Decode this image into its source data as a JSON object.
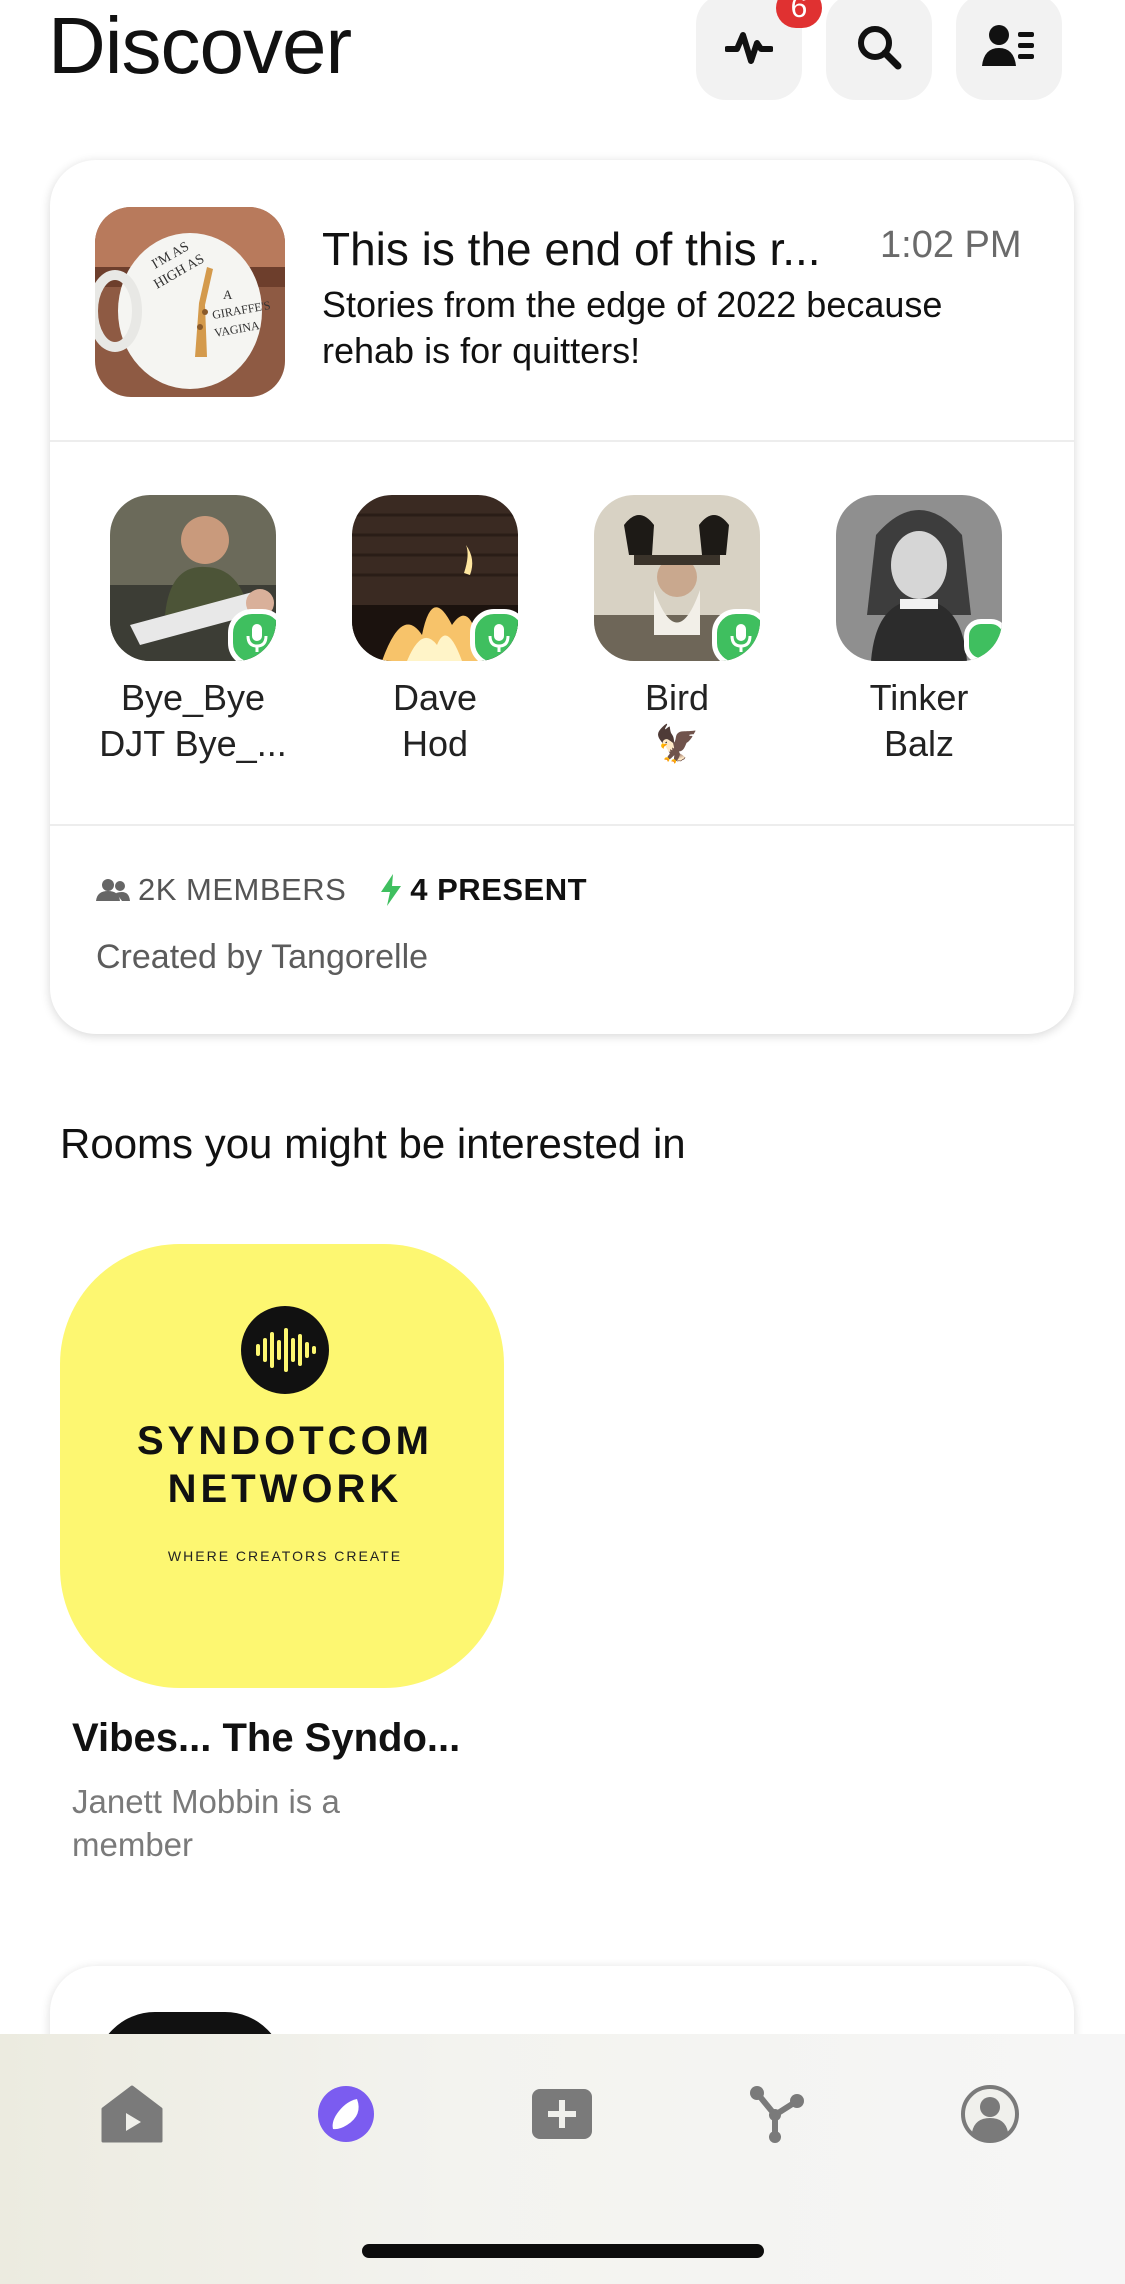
{
  "header": {
    "title": "Discover",
    "activity_badge": "6"
  },
  "featured_room": {
    "cover_text": [
      "I'M AS",
      "HIGH AS",
      "A",
      "GIRAFFE'S",
      "VAGINA"
    ],
    "title": "This is the end of this r...",
    "time": "1:02 PM",
    "description": "Stories from the edge of 2022 because rehab is for quitters!",
    "members": [
      {
        "name_line1": "Bye_Bye",
        "name_line2": "DJT Bye_...",
        "status": "speaking"
      },
      {
        "name_line1": "Dave",
        "name_line2": "Hod",
        "status": "speaking"
      },
      {
        "name_line1": "Bird",
        "name_line2": "🦅",
        "status": "speaking"
      },
      {
        "name_line1": "Tinker",
        "name_line2": "Balz",
        "status": "online"
      }
    ],
    "member_count": "2K MEMBERS",
    "present_count": "4 PRESENT",
    "created_by": "Created by Tangorelle"
  },
  "suggestions": {
    "section_title": "Rooms you might be interested in",
    "rooms": [
      {
        "logo_line1": "SYNDOTCOM",
        "logo_line2": "NETWORK",
        "logo_tagline": "WHERE CREATORS CREATE",
        "name": "Vibes... The Syndo...",
        "subtitle": "Janett Mobbin is a member"
      }
    ]
  },
  "tabbar": {
    "tabs": [
      {
        "icon": "home-icon",
        "active": false
      },
      {
        "icon": "compass-icon",
        "active": true
      },
      {
        "icon": "add-icon",
        "active": false
      },
      {
        "icon": "network-icon",
        "active": false
      },
      {
        "icon": "profile-icon",
        "active": false
      }
    ],
    "active_color": "#7b5cf0",
    "inactive_color": "#8a8a8a"
  },
  "colors": {
    "speaking": "#3fbf5f",
    "badge": "#e03131",
    "tile_yellow": "#fdf771"
  }
}
